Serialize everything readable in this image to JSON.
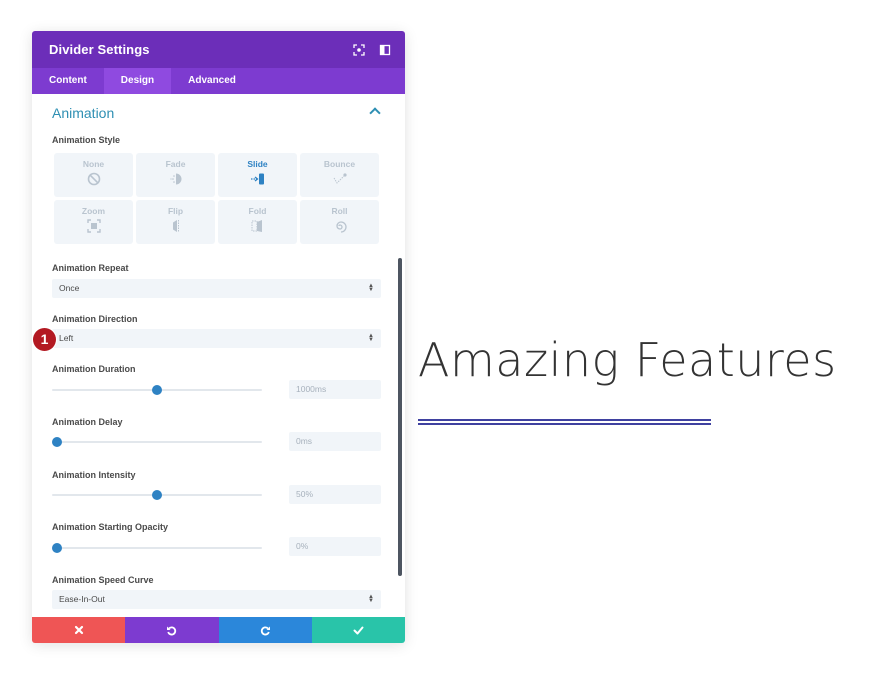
{
  "panel": {
    "title": "Divider Settings",
    "header_icons": [
      "focus-icon",
      "sidebar-toggle-icon"
    ],
    "tabs": [
      {
        "label": "Content",
        "active": false
      },
      {
        "label": "Design",
        "active": true
      },
      {
        "label": "Advanced",
        "active": false
      }
    ],
    "section": {
      "title": "Animation",
      "expanded": true
    },
    "animation_style": {
      "label": "Animation Style",
      "options": [
        {
          "label": "None",
          "icon": "none-icon",
          "active": false
        },
        {
          "label": "Fade",
          "icon": "fade-icon",
          "active": false
        },
        {
          "label": "Slide",
          "icon": "slide-icon",
          "active": true
        },
        {
          "label": "Bounce",
          "icon": "bounce-icon",
          "active": false
        },
        {
          "label": "Zoom",
          "icon": "zoom-icon",
          "active": false
        },
        {
          "label": "Flip",
          "icon": "flip-icon",
          "active": false
        },
        {
          "label": "Fold",
          "icon": "fold-icon",
          "active": false
        },
        {
          "label": "Roll",
          "icon": "roll-icon",
          "active": false
        }
      ]
    },
    "animation_repeat": {
      "label": "Animation Repeat",
      "value": "Once"
    },
    "animation_direction": {
      "label": "Animation Direction",
      "value": "Left"
    },
    "animation_duration": {
      "label": "Animation Duration",
      "value": "1000ms",
      "slider_percent": 50
    },
    "animation_delay": {
      "label": "Animation Delay",
      "value": "0ms",
      "slider_percent": 0
    },
    "animation_intensity": {
      "label": "Animation Intensity",
      "value": "50%",
      "slider_percent": 50
    },
    "animation_starting_opacity": {
      "label": "Animation Starting Opacity",
      "value": "0%",
      "slider_percent": 0
    },
    "animation_speed_curve": {
      "label": "Animation Speed Curve",
      "value": "Ease-In-Out"
    },
    "footer": {
      "buttons": [
        {
          "name": "cancel",
          "icon": "close-icon",
          "color": "#ef5555"
        },
        {
          "name": "undo",
          "icon": "undo-icon",
          "color": "#7d3bd0"
        },
        {
          "name": "redo",
          "icon": "redo-icon",
          "color": "#2b87da"
        },
        {
          "name": "save",
          "icon": "check-icon",
          "color": "#29c4a9"
        }
      ]
    }
  },
  "annotation_badge": "1",
  "preview": {
    "heading": "Amazing Features",
    "divider_color": "#3f41a0"
  },
  "colors": {
    "header": "#6c2eb9",
    "tabs": "#7d3bd0",
    "accent": "#2e82c3",
    "section_title": "#2e8fb3"
  }
}
